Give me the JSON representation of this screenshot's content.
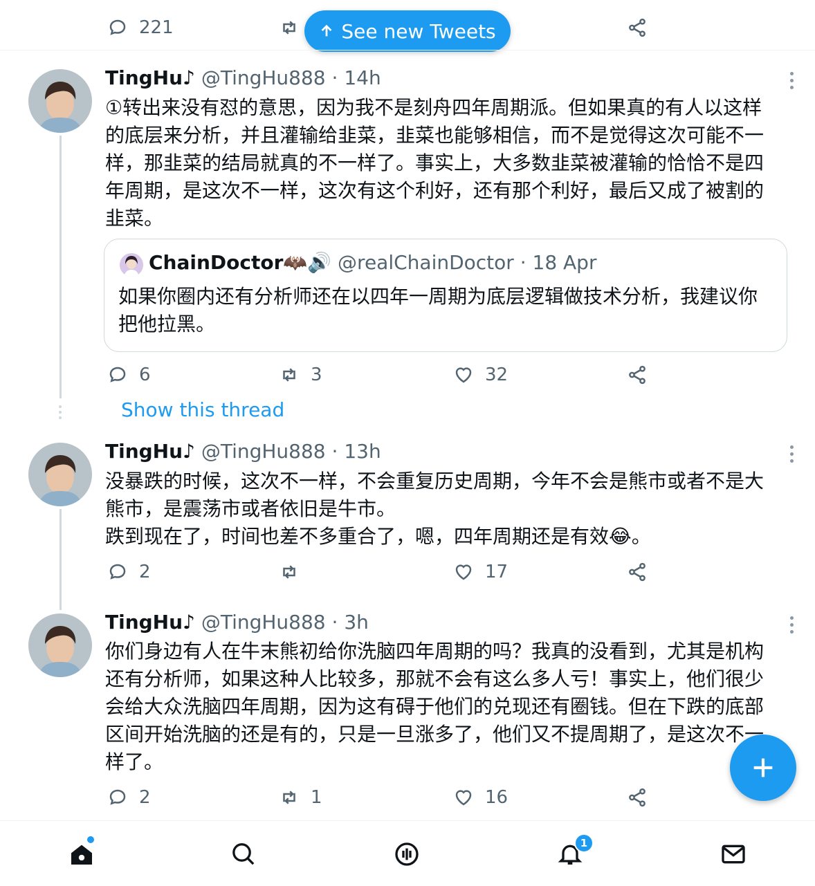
{
  "new_tweets_pill": {
    "label": "See new Tweets"
  },
  "top_actions": {
    "replies": "221"
  },
  "tweets": [
    {
      "name": "TingHu",
      "name_suffix": "♪",
      "handle": "@TingHu888",
      "time": "14h",
      "text": "①转出来没有怼的意思，因为我不是刻舟四年周期派。但如果真的有人以这样的底层来分析，并且灌输给韭菜，韭菜也能够相信，而不是觉得这次可能不一样，那韭菜的结局就真的不一样了。事实上，大多数韭菜被灌输的恰恰不是四年周期，是这次不一样，这次有这个利好，还有那个利好，最后又成了被割的韭菜。",
      "quote": {
        "name": "ChainDoctor🦇🔊",
        "handle": "@realChainDoctor",
        "date": "18 Apr",
        "text": "如果你圈内还有分析师还在以四年一周期为底层逻辑做技术分析，我建议你把他拉黑。"
      },
      "replies": "6",
      "retweets": "3",
      "likes": "32",
      "show_thread": "Show this thread"
    },
    {
      "name": "TingHu",
      "name_suffix": "♪",
      "handle": "@TingHu888",
      "time": "13h",
      "text_line1": "没暴跌的时候，这次不一样，不会重复历史周期，今年不会是熊市或者不是大熊市，是震荡市或者依旧是牛市。",
      "text_line2": "跌到现在了，时间也差不多重合了，嗯，四年周期还是有效😂。",
      "replies": "2",
      "retweets": "",
      "likes": "17"
    },
    {
      "name": "TingHu",
      "name_suffix": "♪",
      "handle": "@TingHu888",
      "time": "3h",
      "text": "你们身边有人在牛末熊初给你洗脑四年周期的吗？我真的没看到，尤其是机构还有分析师，如果这种人比较多，那就不会有这么多人亏！事实上，他们很少会给大众洗脑四年周期，因为这有碍于他们的兑现还有圈钱。但在下跌的底部区间开始洗脑的还是有的，只是一旦涨多了，他们又不提周期了，是这次不一样了。",
      "replies": "2",
      "retweets": "1",
      "likes": "16"
    }
  ],
  "bottom_nav": {
    "items": [
      "home-icon",
      "search-icon",
      "spaces-icon",
      "notifications-icon",
      "messages-icon"
    ],
    "notification_badge": "1"
  },
  "colors": {
    "accent": "#1d9bf0",
    "text": "#0f1419",
    "muted": "#536471",
    "border": "#cfd9de"
  }
}
